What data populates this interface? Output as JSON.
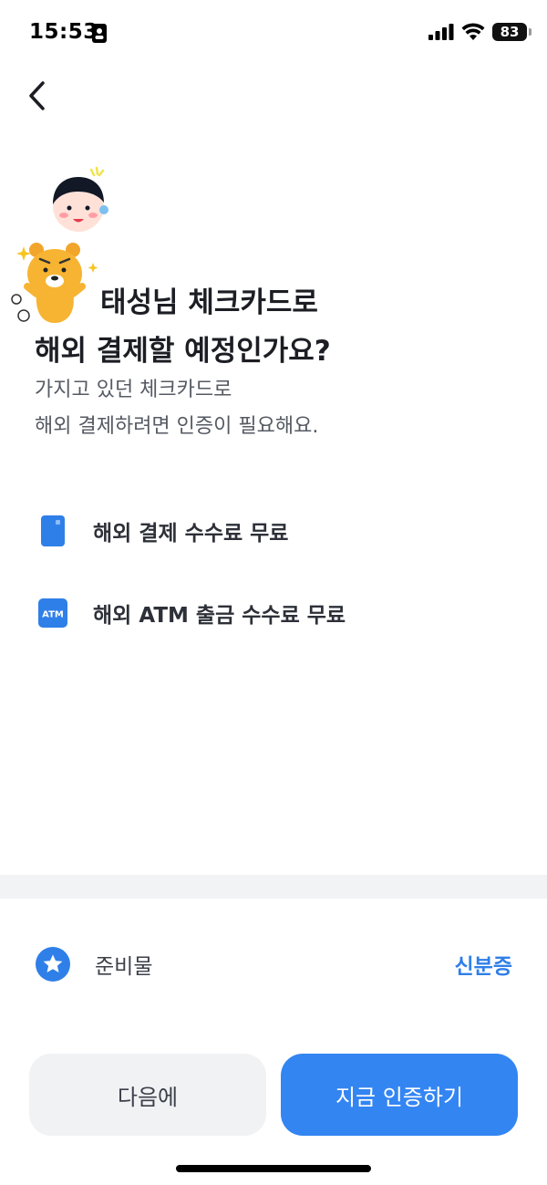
{
  "status": {
    "time": "15:53",
    "battery": "83"
  },
  "headline": {
    "line1": "태성님 체크카드로",
    "line2": "해외 결제할 예정인가요?"
  },
  "subtext": {
    "line1": "가지고 있던 체크카드로",
    "line2": "해외 결제하려면 인증이 필요해요."
  },
  "benefits": [
    {
      "label": "해외 결제 수수료 무료",
      "icon": "card-icon"
    },
    {
      "label": "해외 ATM 출금 수수료 무료",
      "icon": "atm-icon",
      "icon_text": "ATM"
    }
  ],
  "documents": {
    "label": "준비물",
    "value": "신분증",
    "icon": "star-icon"
  },
  "buttons": {
    "later": "다음에",
    "verify": "지금 인증하기"
  },
  "colors": {
    "accent": "#3385f2",
    "icon_blue": "#2f7fe8",
    "divider": "#f1f3f5"
  }
}
